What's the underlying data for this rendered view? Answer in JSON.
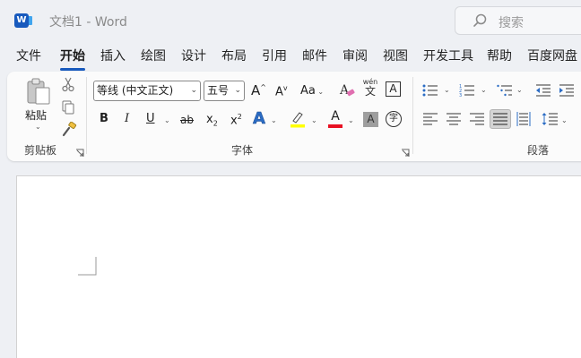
{
  "titlebar": {
    "app_icon_letter": "W",
    "title": "文档1  -  Word",
    "search_placeholder": "搜索"
  },
  "tabs": [
    "文件",
    "开始",
    "插入",
    "绘图",
    "设计",
    "布局",
    "引用",
    "邮件",
    "审阅",
    "视图",
    "开发工具",
    "帮助",
    "百度网盘"
  ],
  "active_tab": "开始",
  "ribbon": {
    "clipboard": {
      "paste_label": "粘贴",
      "group_label": "剪贴板"
    },
    "font": {
      "font_name": "等线 (中文正文)",
      "font_size": "五号",
      "grow_font": "A",
      "shrink_font": "A",
      "change_case": "Aa",
      "phonetic_top": "wén",
      "phonetic_bottom": "文",
      "char_border": "A",
      "bold": "B",
      "italic": "I",
      "underline": "U",
      "strikethrough": "ab",
      "subscript": "x",
      "superscript": "x",
      "text_effects": "A",
      "font_color": "A",
      "char_shading": "A",
      "enclose_char": "字",
      "group_label": "字体"
    },
    "paragraph": {
      "group_label": "段落"
    }
  },
  "colors": {
    "accent": "#185abd",
    "highlight_yellow": "#ffff00",
    "font_color_red": "#e81123",
    "text_effects_blue": "#2b6cc4"
  }
}
